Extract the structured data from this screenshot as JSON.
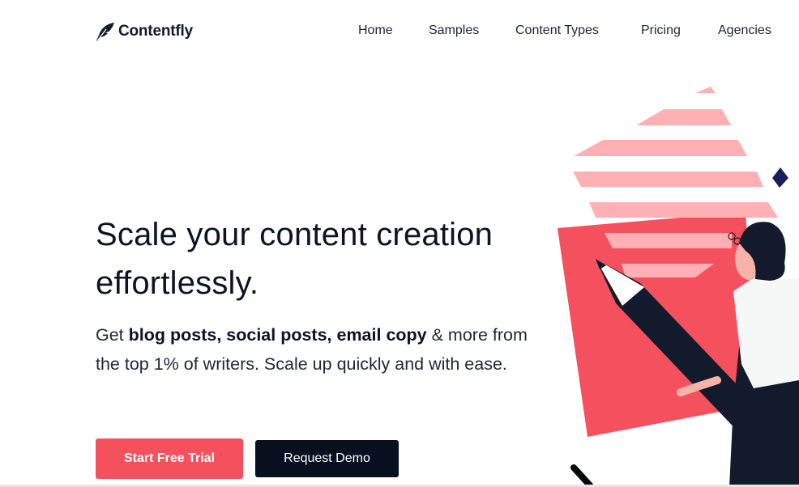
{
  "brand": {
    "name": "Contentfly",
    "logo_icon": "feather-icon",
    "primary_color": "#f5505e",
    "dark_color": "#08101f",
    "stripe_color": "#ffb0b5"
  },
  "nav": {
    "items": [
      {
        "label": "Home"
      },
      {
        "label": "Samples"
      },
      {
        "label": "Content Types"
      },
      {
        "label": "Pricing"
      },
      {
        "label": "Agencies"
      }
    ]
  },
  "hero": {
    "title_line1": "Scale your content creation",
    "title_line2": "effortlessly.",
    "sub_prefix": "Get ",
    "sub_bold": "blog posts, social posts, email copy",
    "sub_suffix": " & more from the top 1% of writers. Scale up quickly and with ease.",
    "cta_primary": "Start Free Trial",
    "cta_secondary": "Request Demo"
  },
  "illustration": {
    "description": "woman-holding-giant-pencil"
  }
}
